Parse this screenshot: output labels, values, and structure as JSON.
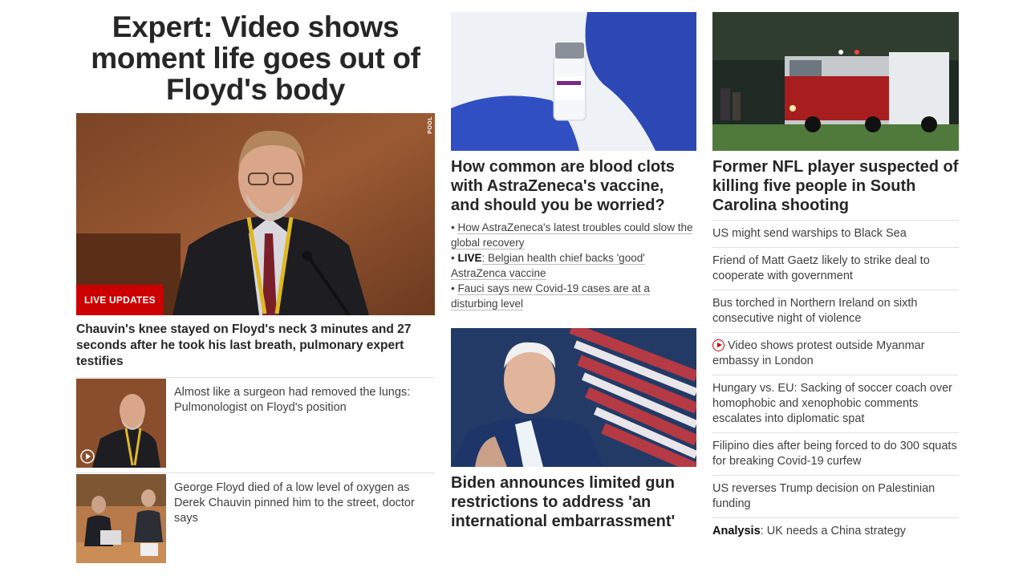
{
  "main": {
    "headline": "Expert: Video shows moment life goes out of Floyd's body",
    "pool_label": "POOL",
    "badge": "LIVE UPDATES",
    "hero_caption": "Chauvin's knee stayed on Floyd's neck 3 minutes and 27 seconds after he took his last breath, pulmonary expert testifies",
    "related": [
      {
        "text": "Almost like a surgeon had removed the lungs: Pulmonologist on Floyd's position"
      },
      {
        "text": "George Floyd died of a low level of oxygen as Derek Chauvin pinned him to the street, doctor says"
      }
    ]
  },
  "middle": {
    "story1": {
      "title": "How common are blood clots with AstraZeneca's vaccine, and should you be worried?",
      "bullets": [
        {
          "prefix": "",
          "text": "How AstraZeneca's latest troubles could slow the global recovery"
        },
        {
          "prefix": "LIVE",
          "text": ": Belgian health chief backs 'good' AstraZenca vaccine"
        },
        {
          "prefix": "",
          "text": "Fauci says new Covid-19 cases are at a disturbing level"
        }
      ]
    },
    "story2": {
      "title": "Biden announces limited gun restrictions to address 'an international embarrassment'"
    }
  },
  "right": {
    "top_title": "Former NFL player suspected of killing five people in South Carolina shooting",
    "items": [
      {
        "text": "US might send warships to Black Sea"
      },
      {
        "text": "Friend of Matt Gaetz likely to strike deal to cooperate with government"
      },
      {
        "text": "Bus torched in Northern Ireland on sixth consecutive night of violence"
      },
      {
        "text": "Video shows protest outside Myanmar embassy in London",
        "icon": "video-play-icon"
      },
      {
        "text": "Hungary vs. EU: Sacking of soccer coach over homophobic and xenophobic comments escalates into diplomatic spat"
      },
      {
        "text": "Filipino dies after being forced to do 300 squats for breaking Covid-19 curfew"
      },
      {
        "text": "US reverses Trump decision on Palestinian funding"
      },
      {
        "prefix": "Analysis",
        "text": ": UK needs a China strategy"
      }
    ]
  },
  "colors": {
    "accent": "#cc0000",
    "text": "#262626"
  }
}
